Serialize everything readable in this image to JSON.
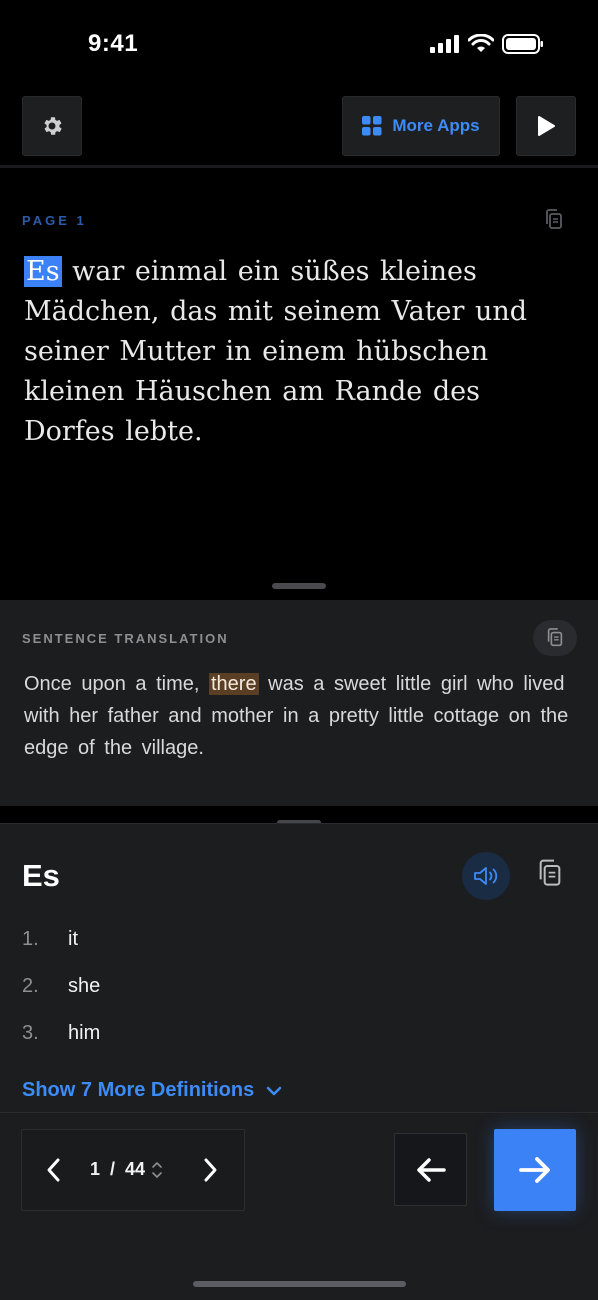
{
  "status_bar": {
    "time": "9:41"
  },
  "toolbar": {
    "more_apps_label": "More Apps",
    "icons": {
      "settings": "gear-icon",
      "apps": "grid-icon",
      "play": "play-icon"
    },
    "accent_color": "#3d8bf7"
  },
  "page": {
    "label": "PAGE 1",
    "highlighted_word": "Es",
    "text_rest": " war einmal ein süßes kleines Mädchen, das mit seinem Vater und seiner Mutter in einem hübschen kleinen Häuschen am Rande des Dorfes lebte."
  },
  "translation": {
    "label": "SENTENCE TRANSLATION",
    "before": "Once upon a time, ",
    "highlight": "there",
    "after": " was a sweet little girl who lived with her father and mother in a pretty little cottage on the edge of the village."
  },
  "dictionary": {
    "word": "Es",
    "definitions": [
      {
        "num": "1.",
        "text": "it"
      },
      {
        "num": "2.",
        "text": "she"
      },
      {
        "num": "3.",
        "text": "him"
      }
    ],
    "more_label": "Show 7 More Definitions"
  },
  "navigation": {
    "current_page": "1",
    "separator": "/",
    "total_pages": "44"
  },
  "colors": {
    "word_highlight": "#3b82f6",
    "translation_highlight": "#5a3f25",
    "primary_button": "#3b82f6"
  }
}
